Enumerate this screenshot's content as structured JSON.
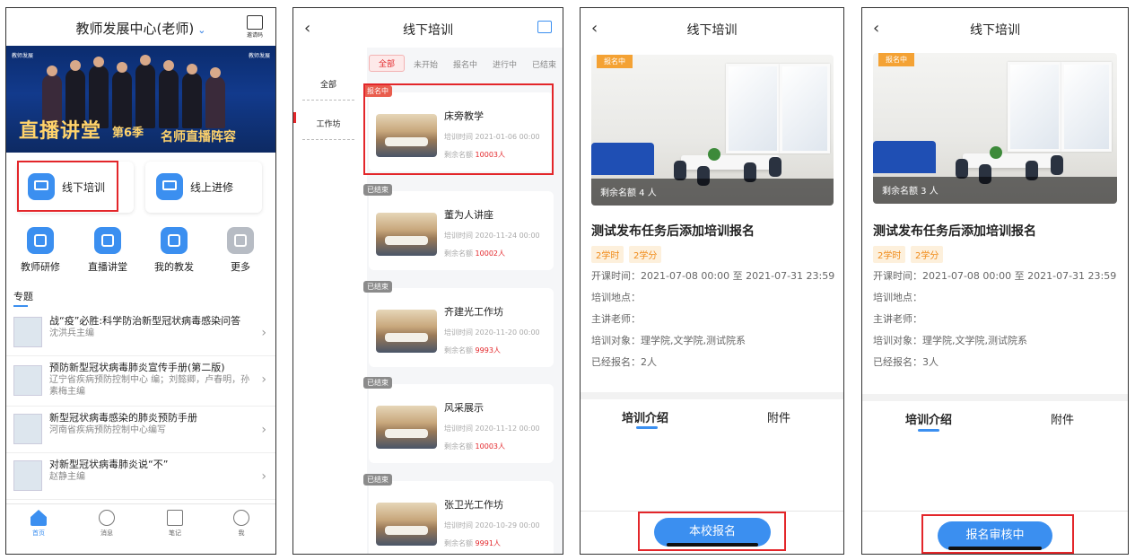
{
  "screen1": {
    "header_title": "教师发展中心(老师)",
    "qr_label": "邀请码",
    "banner": {
      "logo_left": "教师发展",
      "logo_right": "教师发展",
      "text_main": "直播讲堂",
      "text_season": "第6季",
      "text_sub": "名师直播阵容"
    },
    "entries": [
      {
        "label": "线下培训"
      },
      {
        "label": "线上进修"
      }
    ],
    "grid": [
      {
        "label": "教师研修",
        "icon": "checklist-icon"
      },
      {
        "label": "直播讲堂",
        "icon": "video-icon"
      },
      {
        "label": "我的教发",
        "icon": "person-icon"
      },
      {
        "label": "更多",
        "icon": "more-icon"
      }
    ],
    "section_title": "专题",
    "topics": [
      {
        "title": "战“疫”必胜:科学防治新型冠状病毒感染问答",
        "sub": "沈洪兵主编"
      },
      {
        "title": "预防新型冠状病毒肺炎宣传手册(第二版)",
        "sub": "辽宁省疾病预防控制中心 编；刘懿卿，卢春明，孙素梅主编"
      },
      {
        "title": "新型冠状病毒感染的肺炎预防手册",
        "sub": "河南省疾病预防控制中心编写"
      },
      {
        "title": "对新型冠状病毒肺炎说“不”",
        "sub": "赵静主编"
      }
    ],
    "tabbar": [
      {
        "label": "首页",
        "icon": "home-icon"
      },
      {
        "label": "消息",
        "icon": "message-icon"
      },
      {
        "label": "笔记",
        "icon": "note-icon"
      },
      {
        "label": "我",
        "icon": "profile-icon"
      }
    ]
  },
  "screen2": {
    "title": "线下培训",
    "sidebar": [
      "全部",
      "工作坊"
    ],
    "filters": [
      "全部",
      "未开始",
      "报名中",
      "进行中",
      "已结束"
    ],
    "cards": [
      {
        "status": "报名中",
        "name": "床旁教学",
        "time": "培训时间 2021-01-06 00:00",
        "quota_label": "剩余名额",
        "quota": "10003人"
      },
      {
        "status": "已结束",
        "name": "董为人讲座",
        "time": "培训时间 2020-11-24 00:00",
        "quota_label": "剩余名额",
        "quota": "10002人"
      },
      {
        "status": "已结束",
        "name": "齐建光工作坊",
        "time": "培训时间 2020-11-20 00:00",
        "quota_label": "剩余名额",
        "quota": "9993人"
      },
      {
        "status": "已结束",
        "name": "风采展示",
        "time": "培训时间 2020-11-12 00:00",
        "quota_label": "剩余名额",
        "quota": "10003人"
      },
      {
        "status": "已结束",
        "name": "张卫光工作坊",
        "time": "培训时间 2020-10-29 00:00",
        "quota_label": "剩余名额",
        "quota": "9991人"
      }
    ]
  },
  "screen3": {
    "title": "线下培训",
    "tag": "报名中",
    "remaining": "剩余名额 4 人",
    "name": "测试发布任务后添加培训报名",
    "chips": [
      "2学时",
      "2学分"
    ],
    "info": [
      "开课时间：2021-07-08 00:00 至 2021-07-31 23:59",
      "培训地点：",
      "主讲老师：",
      "培训对象：理学院,文学院,测试院系",
      "已经报名：2人"
    ],
    "tabs": [
      "培训介绍",
      "附件"
    ],
    "button": "本校报名"
  },
  "screen4": {
    "title": "线下培训",
    "tag": "报名中",
    "remaining": "剩余名额 3 人",
    "name": "测试发布任务后添加培训报名",
    "chips": [
      "2学时",
      "2学分"
    ],
    "info": [
      "开课时间：2021-07-08 00:00 至 2021-07-31 23:59",
      "培训地点：",
      "主讲老师：",
      "培训对象：理学院,文学院,测试院系",
      "已经报名：3人"
    ],
    "tabs": [
      "培训介绍",
      "附件"
    ],
    "button": "报名审核中"
  },
  "colors": {
    "accent": "#3b8ff0",
    "highlight_red": "#e3262a",
    "badge_orange": "#f4a234"
  }
}
